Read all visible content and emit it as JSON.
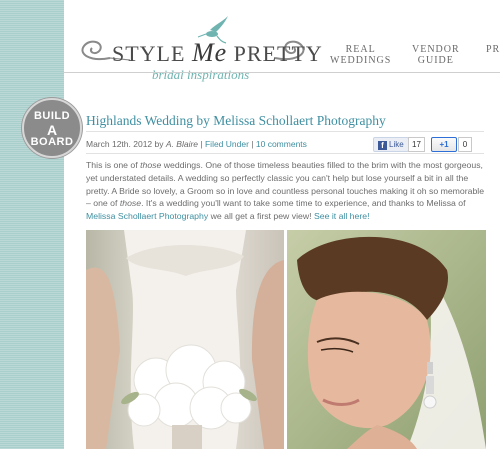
{
  "logo": {
    "wordmark_left": "STYLE",
    "wordmark_middle": "Me",
    "wordmark_right": "PRETTY",
    "tagline": "bridal inspirations"
  },
  "nav": {
    "items": [
      {
        "line1": "REAL",
        "line2": "WEDDINGS"
      },
      {
        "line1": "VENDOR",
        "line2": "GUIDE"
      },
      {
        "line1": "PR",
        "line2": ""
      }
    ]
  },
  "badge": {
    "line1": "BUILD",
    "line2": "A",
    "line3": "BOARD"
  },
  "post": {
    "title": "Highlands Wedding by Melissa Schollaert Photography",
    "date": "March 12th. 2012",
    "by_label": "by",
    "author": "A. Blaire",
    "separator": "|",
    "filed_under": "Filed Under",
    "comments": "10 comments"
  },
  "social": {
    "fb_icon": "f",
    "fb_label": "Like",
    "fb_count": "17",
    "gplus_label": "+1",
    "gplus_count": "0"
  },
  "body": {
    "p1": "This is one of",
    "p1_em": "those",
    "p2": "weddings. One of those timeless beauties filled to the brim with the most gorgeous, yet understated details. A wedding so perfectly classic you can't help but lose yourself a bit in all the pretty. A Bride so lovely, a Groom so in love and countless personal touches making it oh so memorable – one of",
    "p2_em": "those",
    "p3": ". It's a wedding you'll want to take some time to experience, and thanks to Melissa of",
    "link1": "Melissa Schollaert Photography",
    "p4": "we all get a first pew view!",
    "link2": "See it all here!"
  },
  "colors": {
    "accent": "#3e8fa1",
    "stripe": "#bcd8d6",
    "badge": "#8b8b8b",
    "teal_script": "#6fb4b0"
  }
}
